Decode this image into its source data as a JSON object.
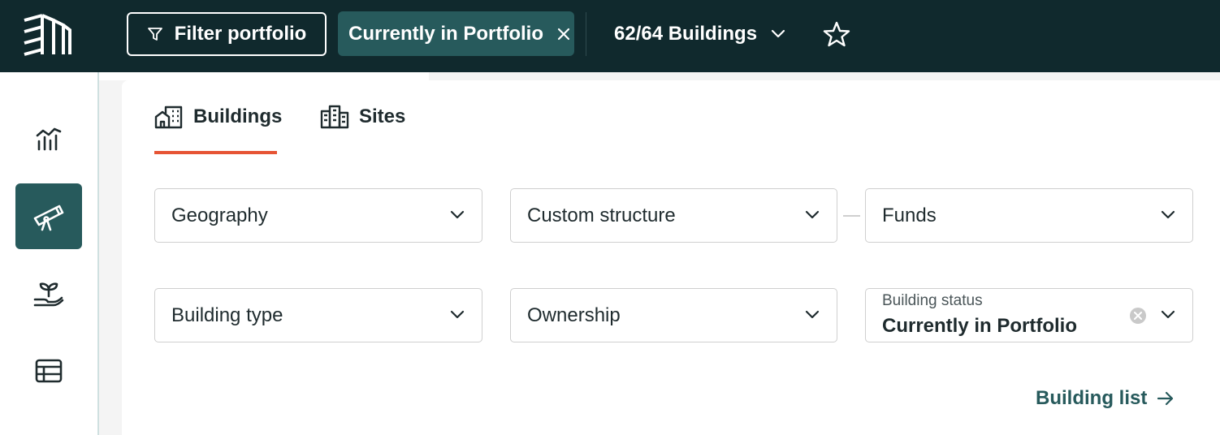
{
  "header": {
    "logo_icon": "building-logo-icon",
    "filter_button_label": "Filter portfolio",
    "active_filter_chip": "Currently in Portfolio",
    "building_count": "62/64 Buildings",
    "colors": {
      "topbar": "#10292d",
      "chip": "#275a5c",
      "accent": "#e65434"
    }
  },
  "sidebar": {
    "items": [
      {
        "icon": "chart-icon"
      },
      {
        "icon": "telescope-icon",
        "active": true
      },
      {
        "icon": "sprout-hand-icon"
      },
      {
        "icon": "table-icon"
      }
    ]
  },
  "tabs": [
    {
      "label": "Buildings",
      "icon": "buildings-icon",
      "active": true
    },
    {
      "label": "Sites",
      "icon": "sites-icon"
    }
  ],
  "filters": {
    "geography": "Geography",
    "custom_structure": "Custom structure",
    "funds": "Funds",
    "building_type": "Building type",
    "ownership": "Ownership",
    "building_status": {
      "label": "Building status",
      "value": "Currently in Portfolio"
    }
  },
  "footer": {
    "building_list_link": "Building list"
  }
}
